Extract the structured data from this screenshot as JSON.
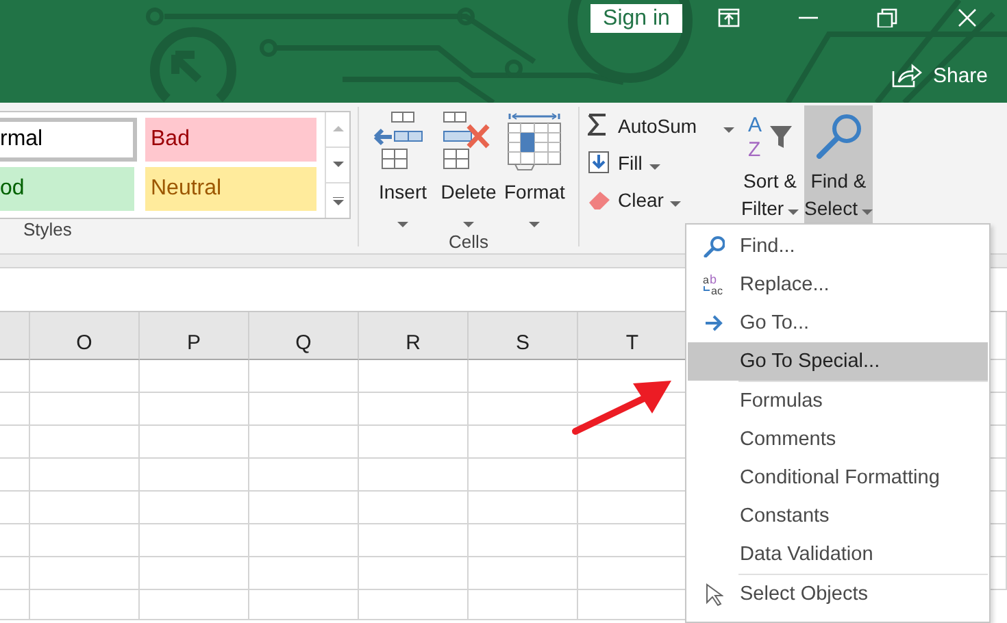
{
  "window": {
    "sign_in": "Sign in",
    "share": "Share"
  },
  "ribbon": {
    "styles": {
      "items": [
        {
          "label": "rmal",
          "kind": "normal"
        },
        {
          "label": "Bad",
          "kind": "bad"
        },
        {
          "label": "od",
          "kind": "good"
        },
        {
          "label": "Neutral",
          "kind": "neutral"
        }
      ],
      "group_label": "Styles"
    },
    "cells": {
      "buttons": [
        {
          "label": "Insert",
          "kind": "insert"
        },
        {
          "label": "Delete",
          "kind": "delete"
        },
        {
          "label": "Format",
          "kind": "format"
        }
      ],
      "group_label": "Cells"
    },
    "editing": {
      "small_buttons": [
        {
          "label": "AutoSum",
          "kind": "sum"
        },
        {
          "label": "Fill",
          "kind": "fill"
        },
        {
          "label": "Clear",
          "kind": "clear"
        }
      ],
      "large_buttons": [
        {
          "lines": [
            "Sort &",
            "Filter"
          ],
          "kind": "sort",
          "icon_letters": [
            "A",
            "Z"
          ],
          "pressed": false
        },
        {
          "lines": [
            "Find &",
            "Select"
          ],
          "kind": "find",
          "pressed": true
        }
      ]
    }
  },
  "sheet": {
    "columns": [
      "O",
      "P",
      "Q",
      "R",
      "S",
      "T"
    ]
  },
  "menu": {
    "items": [
      {
        "label": "Find...",
        "kind": "find",
        "selected": false
      },
      {
        "label": "Replace...",
        "kind": "replace",
        "icon_letters": [
          "a",
          "b",
          "ac"
        ],
        "selected": false
      },
      {
        "label": "Go To...",
        "kind": "goto",
        "selected": false
      },
      {
        "label": "Go To Special...",
        "kind": "plain",
        "selected": true
      },
      {
        "label": "Formulas",
        "kind": "plain",
        "selected": false
      },
      {
        "label": "Comments",
        "kind": "plain",
        "selected": false
      },
      {
        "label": "Conditional Formatting",
        "kind": "plain",
        "selected": false
      },
      {
        "label": "Constants",
        "kind": "plain",
        "selected": false
      },
      {
        "label": "Data Validation",
        "kind": "plain",
        "selected": false
      },
      {
        "label": "Select Objects",
        "kind": "select",
        "selected": false
      }
    ]
  }
}
